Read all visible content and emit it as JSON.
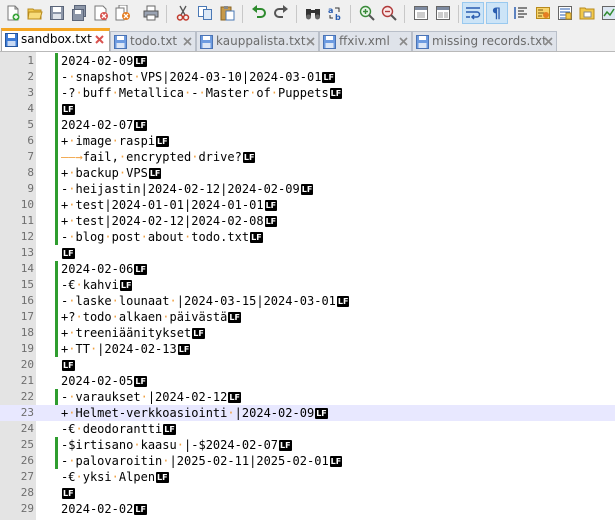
{
  "toolbar": {
    "buttons": [
      {
        "icon": "new-file-icon"
      },
      {
        "icon": "open-file-icon"
      },
      {
        "icon": "save-icon"
      },
      {
        "icon": "save-all-icon"
      },
      {
        "icon": "close-icon"
      },
      {
        "icon": "close-all-icon"
      },
      {
        "icon": "print-icon"
      },
      {
        "icon": "cut-icon"
      },
      {
        "icon": "copy-icon"
      },
      {
        "icon": "paste-icon"
      },
      {
        "icon": "undo-icon"
      },
      {
        "icon": "redo-icon"
      },
      {
        "icon": "find-icon"
      },
      {
        "icon": "replace-icon"
      },
      {
        "icon": "zoom-in-icon"
      },
      {
        "icon": "zoom-out-icon"
      },
      {
        "icon": "sync-vertical-icon"
      },
      {
        "icon": "sync-horizontal-icon"
      },
      {
        "icon": "word-wrap-icon",
        "active": true
      },
      {
        "icon": "show-all-characters-icon",
        "active": true
      },
      {
        "icon": "indent-guide-icon"
      },
      {
        "icon": "document-map-icon"
      },
      {
        "icon": "function-list-icon"
      },
      {
        "icon": "folder-as-workspace-icon"
      },
      {
        "icon": "monitoring-icon"
      }
    ]
  },
  "tabs": [
    {
      "label": "sandbox.txt",
      "active": true,
      "icon": "file-icon"
    },
    {
      "label": "todo.txt",
      "active": false,
      "icon": "file-icon"
    },
    {
      "label": "kauppalista.txt",
      "active": false,
      "icon": "file-icon"
    },
    {
      "label": "ffxiv.xml",
      "active": false,
      "icon": "file-icon"
    },
    {
      "label": "missing records.txt",
      "active": false,
      "icon": "file-icon"
    }
  ],
  "colors": {
    "change_marker": "#2f9d2f",
    "whitespace_marker": "#f0a040",
    "active_tab_accent": "#f5a623",
    "current_line": "#e8e8ff"
  },
  "editor": {
    "eol_marker": "LF",
    "current_line": 23,
    "lines": [
      {
        "n": 1,
        "text": "2024-02-09"
      },
      {
        "n": 2,
        "text": "- snapshot VPS|2024-03-10|2024-03-01"
      },
      {
        "n": 3,
        "text": "-? buff Metallica - Master of Puppets"
      },
      {
        "n": 4,
        "text": ""
      },
      {
        "n": 5,
        "text": "2024-02-07"
      },
      {
        "n": 6,
        "text": "+ image raspi"
      },
      {
        "n": 7,
        "text": "\tfail, encrypted drive?"
      },
      {
        "n": 8,
        "text": "+ backup VPS"
      },
      {
        "n": 9,
        "text": "- heijastin|2024-02-12|2024-02-09"
      },
      {
        "n": 10,
        "text": "+ test|2024-01-01|2024-01-01"
      },
      {
        "n": 11,
        "text": "+ test|2024-02-12|2024-02-08"
      },
      {
        "n": 12,
        "text": "- blog post about todo.txt"
      },
      {
        "n": 13,
        "text": ""
      },
      {
        "n": 14,
        "text": "2024-02-06"
      },
      {
        "n": 15,
        "text": "-€ kahvi"
      },
      {
        "n": 16,
        "text": "- laske lounaat |2024-03-15|2024-03-01"
      },
      {
        "n": 17,
        "text": "+? todo alkaen päivästä"
      },
      {
        "n": 18,
        "text": "+ treeniäänitykset"
      },
      {
        "n": 19,
        "text": "+ TT |2024-02-13"
      },
      {
        "n": 20,
        "text": ""
      },
      {
        "n": 21,
        "text": "2024-02-05"
      },
      {
        "n": 22,
        "text": "- varaukset |2024-02-12"
      },
      {
        "n": 23,
        "text": "+ Helmet-verkkoasiointi |2024-02-09"
      },
      {
        "n": 24,
        "text": "-€ deodorantti"
      },
      {
        "n": 25,
        "text": "-$irtisano kaasu |-$2024-02-07"
      },
      {
        "n": 26,
        "text": "- palovaroitin |2025-02-11|2025-02-01"
      },
      {
        "n": 27,
        "text": "-€ yksi Alpen"
      },
      {
        "n": 28,
        "text": ""
      },
      {
        "n": 29,
        "text": "2024-02-02"
      }
    ]
  }
}
